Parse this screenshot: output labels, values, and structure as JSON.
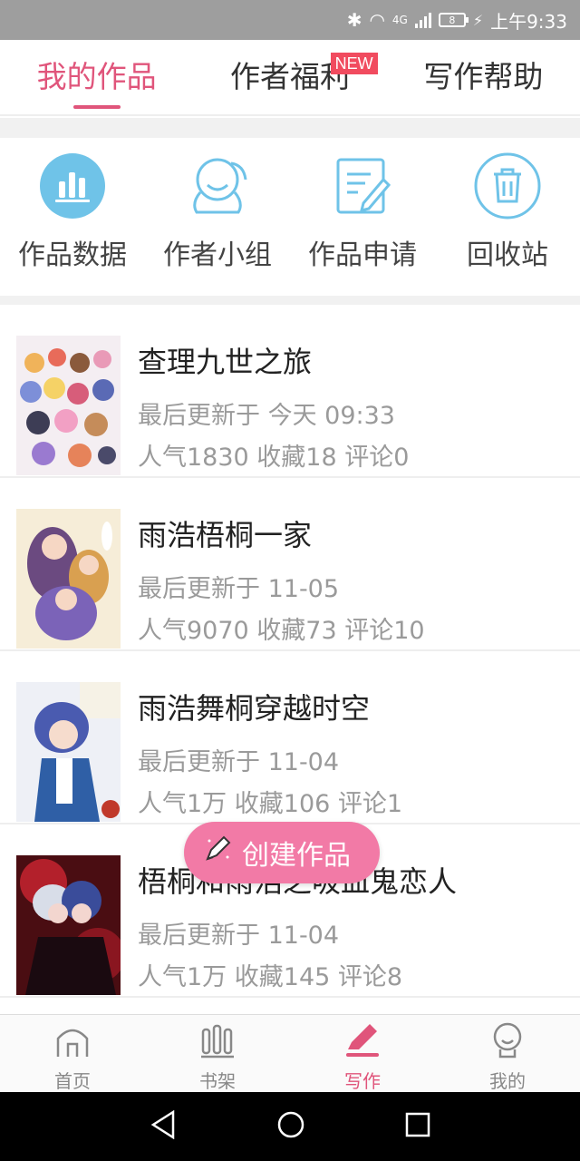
{
  "status_bar": {
    "signal_label": "4G",
    "battery": "8",
    "time": "上午9:33"
  },
  "top_tabs": [
    {
      "label": "我的作品",
      "active": true
    },
    {
      "label": "作者福利",
      "badge": "NEW"
    },
    {
      "label": "写作帮助"
    }
  ],
  "quick_actions": [
    {
      "label": "作品数据",
      "icon": "bar-chart-icon"
    },
    {
      "label": "作者小组",
      "icon": "group-icon"
    },
    {
      "label": "作品申请",
      "icon": "edit-document-icon"
    },
    {
      "label": "回收站",
      "icon": "trash-icon"
    }
  ],
  "works": [
    {
      "title": "查理九世之旅",
      "updated": "最后更新于 今天 09:33",
      "stats": "人气1830 收藏18 评论0"
    },
    {
      "title": "雨浩梧桐一家",
      "updated": "最后更新于 11-05",
      "stats": "人气9070 收藏73 评论10"
    },
    {
      "title": "雨浩舞桐穿越时空",
      "updated": "最后更新于 11-04",
      "stats": "人气1万 收藏106 评论1"
    },
    {
      "title": "梧桐和雨浩之吸血鬼恋人",
      "updated": "最后更新于 11-04",
      "stats": "人气1万 收藏145 评论8"
    }
  ],
  "fab": {
    "label": "创建作品"
  },
  "bottom_nav": [
    {
      "label": "首页"
    },
    {
      "label": "书架"
    },
    {
      "label": "写作",
      "active": true
    },
    {
      "label": "我的"
    }
  ],
  "colors": {
    "accent": "#e0557b",
    "icon_blue": "#6fc3e8",
    "fab": "#f27aa6",
    "badge": "#f14b5f"
  }
}
